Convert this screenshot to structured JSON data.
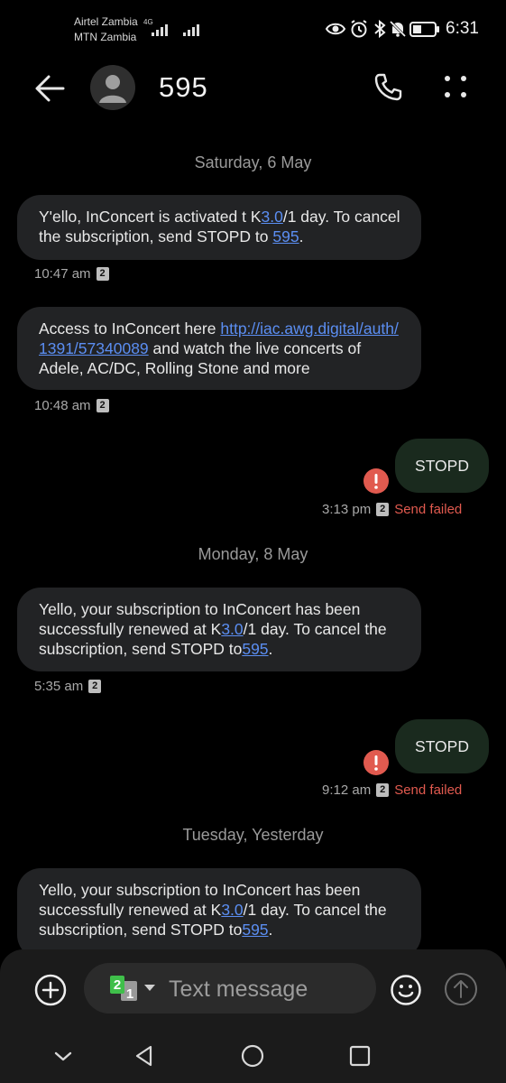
{
  "status_bar": {
    "carrier1": "Airtel Zambia",
    "carrier1_net": "4G",
    "carrier2": "MTN Zambia",
    "time": "6:31",
    "icons": [
      "eye-icon",
      "alarm-icon",
      "bluetooth-icon",
      "mute-icon",
      "battery-icon"
    ]
  },
  "header": {
    "contact": "595",
    "icons": [
      "back-arrow-icon",
      "avatar",
      "phone-icon",
      "more-icon"
    ]
  },
  "conversation": {
    "dates": [
      "Saturday, 6 May",
      "Monday, 8 May",
      "Tuesday, Yesterday"
    ],
    "messages": [
      {
        "direction": "in",
        "parts": [
          "Y'ello,  InConcert is activated t K",
          "3.0",
          "/1 day. To cancel the subscription, send STOPD to ",
          "595",
          "."
        ],
        "time": "10:47 am",
        "sim": "2"
      },
      {
        "direction": "in",
        "parts": [
          "Access to InConcert here ",
          "http://iac.awg.digital/auth/1391/57340089",
          " and watch the live concerts of Adele, AC/DC, Rolling Stone and more"
        ],
        "time": "10:48 am",
        "sim": "2"
      },
      {
        "direction": "out",
        "text": "STOPD",
        "time": "3:13 pm",
        "sim": "2",
        "status": "Send failed"
      },
      {
        "direction": "in",
        "parts": [
          "Yello, your subscription to InConcert has been successfully renewed at K",
          "3.0",
          "/1 day. To cancel the subscription, send STOPD to",
          "595",
          "."
        ],
        "time": "5:35 am",
        "sim": "2"
      },
      {
        "direction": "out",
        "text": "STOPD",
        "time": "9:12 am",
        "sim": "2",
        "status": "Send failed"
      },
      {
        "direction": "in",
        "parts": [
          "Yello, your subscription to InConcert has been successfully renewed at K",
          "3.0",
          "/1 day. To cancel the subscription, send STOPD to",
          "595",
          "."
        ]
      }
    ]
  },
  "composer": {
    "sim_front": "2",
    "sim_back": "1",
    "placeholder": "Text message"
  },
  "colors": {
    "link": "#5b8ef2",
    "error": "#e15a4f",
    "incoming_bubble": "#222325",
    "outgoing_bubble": "#1a2a1e",
    "sim_green": "#3fbf4a"
  }
}
